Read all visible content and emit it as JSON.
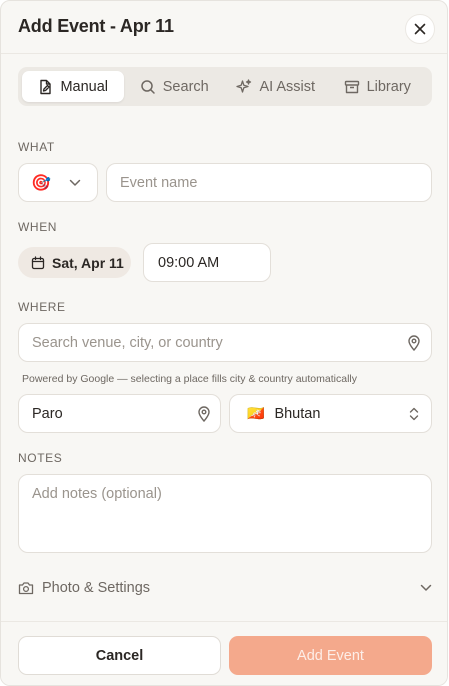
{
  "header": {
    "title": "Add Event - Apr 11",
    "close_icon": "close-icon"
  },
  "tabs": [
    {
      "label": "Manual",
      "icon": "document-edit-icon",
      "active": true
    },
    {
      "label": "Search",
      "icon": "search-icon",
      "active": false
    },
    {
      "label": "AI Assist",
      "icon": "sparkle-icon",
      "active": false
    },
    {
      "label": "Library",
      "icon": "archive-box-icon",
      "active": false
    }
  ],
  "what": {
    "label": "WHAT",
    "emoji": "🎯",
    "name_placeholder": "Event name"
  },
  "when": {
    "label": "WHEN",
    "date": "Sat, Apr 11",
    "time": "09:00 AM"
  },
  "where": {
    "label": "WHERE",
    "search_placeholder": "Search venue, city, or country",
    "helper": "Powered by Google — selecting a place fills city & country automatically",
    "city": "Paro",
    "country_flag": "🇧🇹",
    "country": "Bhutan"
  },
  "notes": {
    "label": "NOTES",
    "placeholder": "Add notes (optional)"
  },
  "photo_settings": {
    "label": "Photo & Settings"
  },
  "footer": {
    "cancel_label": "Cancel",
    "add_label": "Add Event"
  },
  "colors": {
    "accent": "#f4a98c",
    "background": "#f8f7f4",
    "chip": "#efe9e3"
  }
}
